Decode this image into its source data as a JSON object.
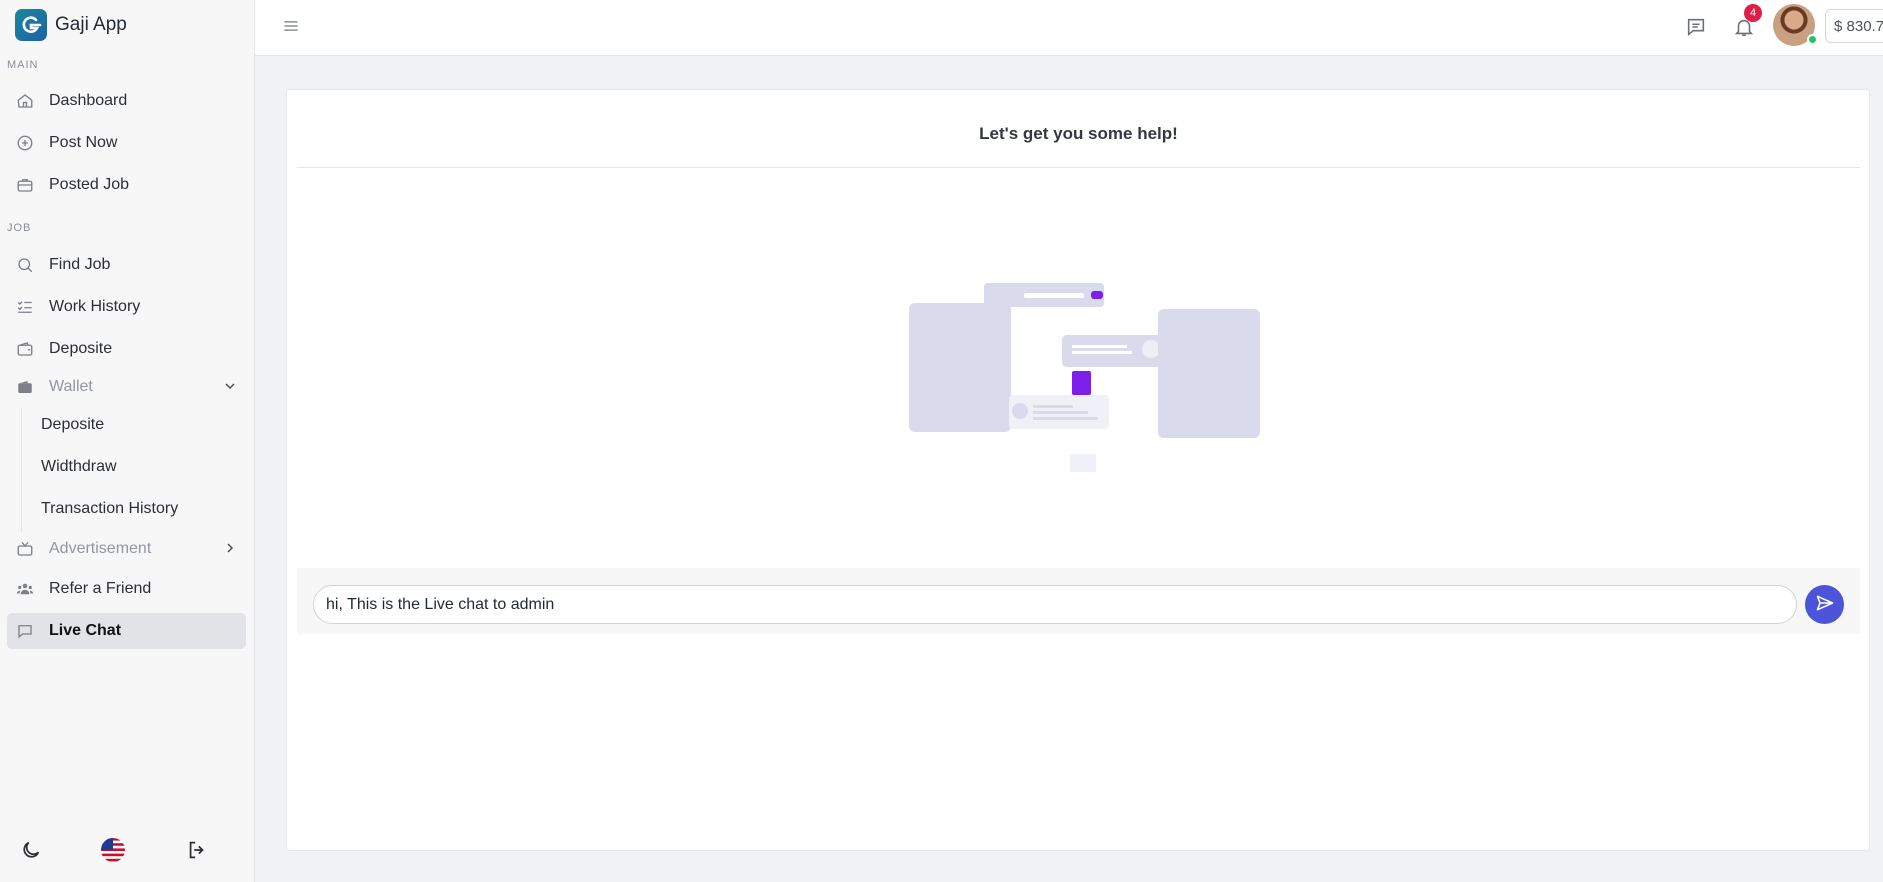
{
  "app": {
    "name": "Gaji App"
  },
  "sidebar": {
    "sections": {
      "main": "MAIN",
      "job": "JOB"
    },
    "items": [
      {
        "label": "Dashboard",
        "icon": "home-icon"
      },
      {
        "label": "Post Now",
        "icon": "plus-circle-icon"
      },
      {
        "label": "Posted Job",
        "icon": "briefcase-icon"
      },
      {
        "label": "Find Job",
        "icon": "search-icon"
      },
      {
        "label": "Work History",
        "icon": "list-check-icon"
      },
      {
        "label": "Deposite",
        "icon": "wallet-icon"
      },
      {
        "label": "Wallet",
        "icon": "wallet-icon",
        "expanded": true
      },
      {
        "label": "Advertisement",
        "icon": "tv-icon",
        "expanded": false
      },
      {
        "label": "Refer a Friend",
        "icon": "users-icon"
      },
      {
        "label": "Live Chat",
        "icon": "chat-icon",
        "active": true
      }
    ],
    "wallet_sub": [
      {
        "label": "Deposite"
      },
      {
        "label": "Widthdraw"
      },
      {
        "label": "Transaction History"
      }
    ],
    "footer": [
      "moon-icon",
      "us-flag-icon",
      "logout-icon"
    ]
  },
  "topbar": {
    "notification_count": "4",
    "balance": "$ 830.7"
  },
  "chat": {
    "heading": "Let's get you some help!",
    "input_value": "hi, This is the Live chat to admin"
  },
  "colors": {
    "accent": "#4c55d9",
    "badge": "#e11d48",
    "online": "#22c55e",
    "illustration_purple": "#7c1fe8"
  }
}
